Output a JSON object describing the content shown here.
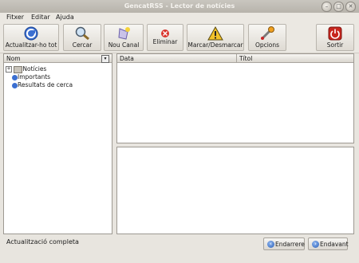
{
  "window": {
    "title": "GencatRSS - Lector de notícies",
    "controls": [
      "–",
      "□",
      "✕"
    ]
  },
  "menu": [
    {
      "label": "Fitxer"
    },
    {
      "label": "Editar"
    },
    {
      "label": "Ajuda"
    }
  ],
  "toolbar": [
    {
      "label": "Actualitzar-ho tot",
      "icon": "refresh-globe-icon"
    },
    {
      "label": "Cercar",
      "icon": "search-magnifier-icon"
    },
    {
      "label": "Nou Canal",
      "icon": "new-channel-icon"
    },
    {
      "label": "Eliminar",
      "icon": "delete-icon"
    },
    {
      "label": "Marcar/Desmarcar",
      "icon": "warning-mark-icon"
    },
    {
      "label": "Opcions",
      "icon": "options-wrench-icon"
    },
    {
      "label": "Sortir",
      "icon": "power-exit-icon"
    }
  ],
  "tree": {
    "column_header": "Nom",
    "items": [
      {
        "label": "Notícies",
        "icon": "folder-icon",
        "expandable": true
      },
      {
        "label": "Importants",
        "icon": "feed-icon"
      },
      {
        "label": "Resultats de cerca",
        "icon": "feed-icon"
      }
    ]
  },
  "list": {
    "columns": [
      "Data",
      "Títol"
    ]
  },
  "status": {
    "text": "Actualització completa"
  },
  "nav": {
    "back_label": "Endarrere",
    "forward_label": "Endavant"
  },
  "colors": {
    "accent_blue": "#3b6fd1",
    "exit_red": "#c8261e",
    "warning_yellow": "#f2c22a"
  }
}
